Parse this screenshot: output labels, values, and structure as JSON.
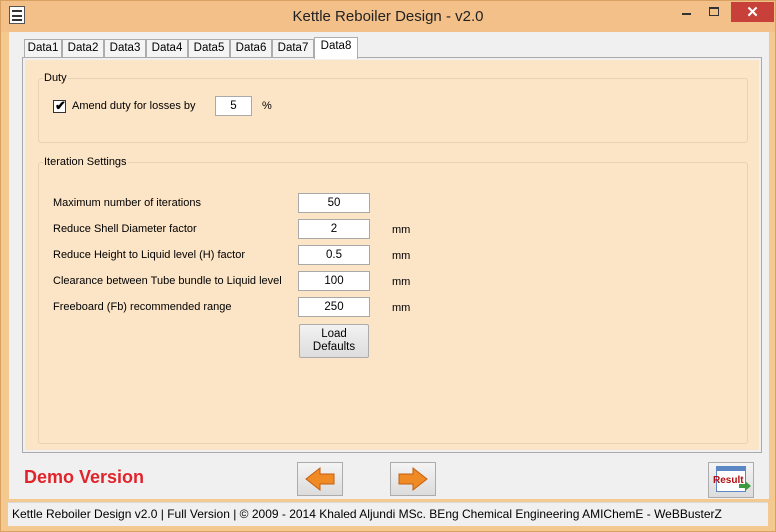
{
  "window": {
    "title": "Kettle Reboiler Design - v2.0"
  },
  "tabs": [
    "Data1",
    "Data2",
    "Data3",
    "Data4",
    "Data5",
    "Data6",
    "Data7",
    "Data8"
  ],
  "active_tab": "Data8",
  "duty": {
    "group_label": "Duty",
    "amend_label": "Amend duty for losses by",
    "amend_checked": true,
    "amend_value": "5",
    "amend_unit": "%"
  },
  "iteration": {
    "group_label": "Iteration Settings",
    "rows": [
      {
        "label": "Maximum number of iterations",
        "value": "50",
        "unit": ""
      },
      {
        "label": "Reduce Shell Diameter factor",
        "value": "2",
        "unit": "mm"
      },
      {
        "label": "Reduce Height to Liquid level (H) factor",
        "value": "0.5",
        "unit": "mm"
      },
      {
        "label": "Clearance between Tube bundle to Liquid level",
        "value": "100",
        "unit": "mm"
      },
      {
        "label": "Freeboard (Fb) recommended range",
        "value": "250",
        "unit": "mm"
      }
    ],
    "load_defaults_line1": "Load",
    "load_defaults_line2": "Defaults"
  },
  "footer": {
    "demo_text": "Demo Version",
    "result_label": "Result",
    "status_text": "Kettle Reboiler Design  v2.0  |  Full Version  |  © 2009 - 2014 Khaled Aljundi MSc. BEng Chemical Engineering AMIChemE - WeBBusterZ"
  },
  "colors": {
    "accent_window": "#f4c98f",
    "panel_bg": "#fce4c6",
    "demo_red": "#e0242b",
    "arrow_orange": "#f08a24",
    "close_red": "#c7413a"
  },
  "icons": [
    "app-icon",
    "minimize-icon",
    "maximize-icon",
    "close-icon",
    "checkmark-icon",
    "arrow-left-icon",
    "arrow-right-icon",
    "result-icon"
  ]
}
